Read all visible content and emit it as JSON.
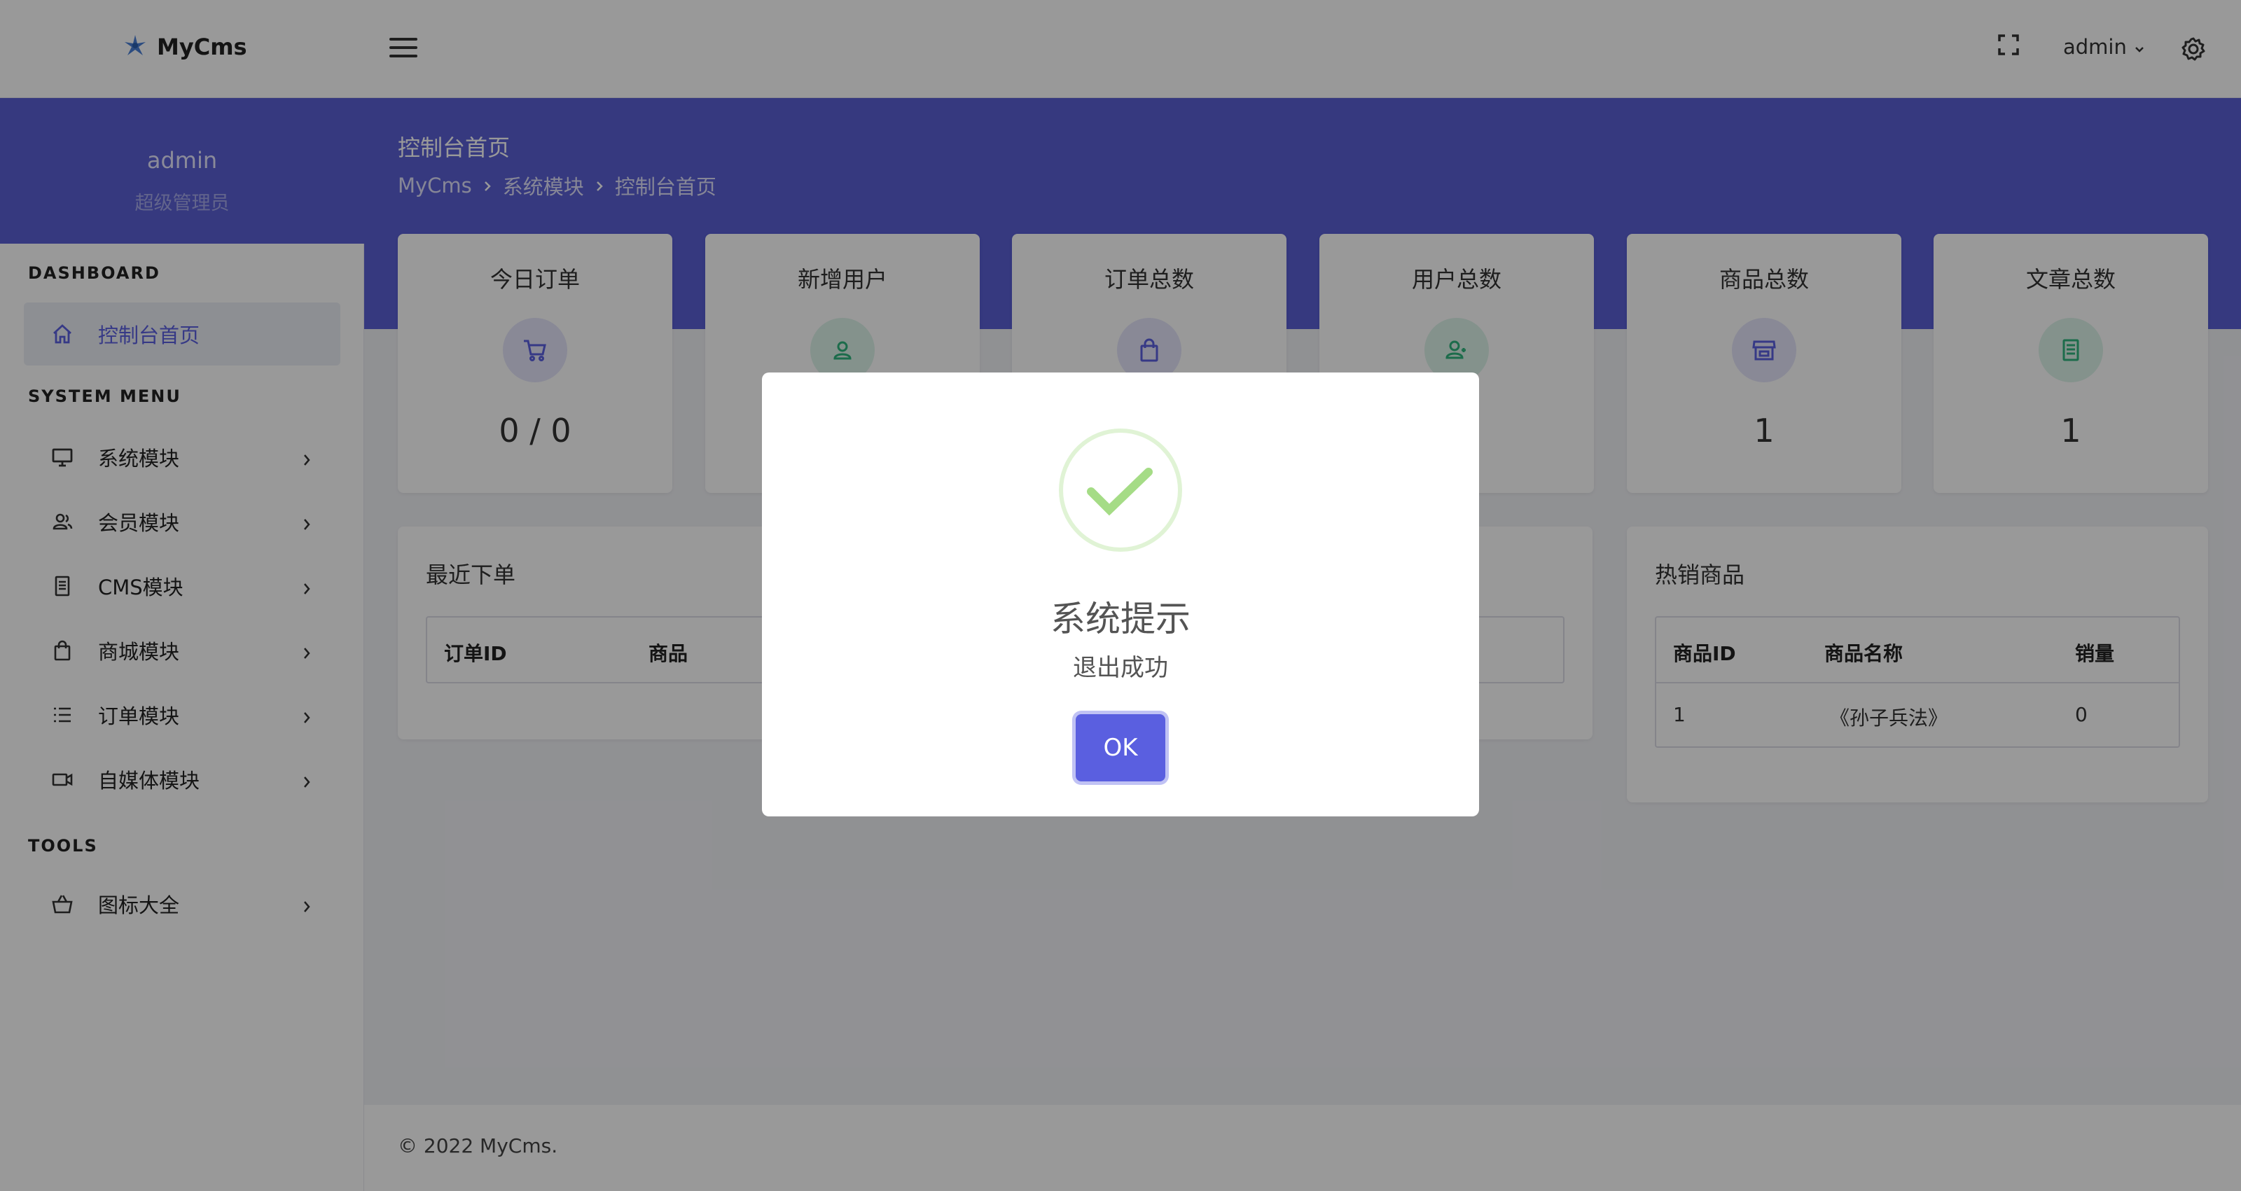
{
  "app": {
    "logo_text": "MyCms",
    "user_menu": "admin"
  },
  "sidebar": {
    "profile": {
      "name": "admin",
      "role": "超级管理员"
    },
    "sections": {
      "dashboard": "DASHBOARD",
      "system_menu": "SYSTEM MENU",
      "tools": "TOOLS"
    },
    "items": [
      {
        "label": "控制台首页",
        "icon": "home-icon",
        "active": true
      },
      {
        "label": "系统模块",
        "icon": "monitor-icon"
      },
      {
        "label": "会员模块",
        "icon": "users-icon"
      },
      {
        "label": "CMS模块",
        "icon": "document-icon"
      },
      {
        "label": "商城模块",
        "icon": "shopping-bag-icon"
      },
      {
        "label": "订单模块",
        "icon": "list-icon"
      },
      {
        "label": "自媒体模块",
        "icon": "video-icon"
      },
      {
        "label": "图标大全",
        "icon": "basket-icon"
      }
    ]
  },
  "page": {
    "title": "控制台首页",
    "breadcrumb": [
      "MyCms",
      "系统模块",
      "控制台首页"
    ]
  },
  "stats": [
    {
      "title": "今日订单",
      "value": "0 / 0",
      "icon": "cart-icon",
      "color": "#5a5fe0"
    },
    {
      "title": "新增用户",
      "value": "",
      "icon": "user-icon",
      "color": "#2fb57e"
    },
    {
      "title": "订单总数",
      "value": "",
      "icon": "bag-icon",
      "color": "#5a5fe0"
    },
    {
      "title": "用户总数",
      "value": "",
      "icon": "user-group-icon",
      "color": "#2fb57e"
    },
    {
      "title": "商品总数",
      "value": "1",
      "icon": "store-icon",
      "color": "#5a5fe0"
    },
    {
      "title": "文章总数",
      "value": "1",
      "icon": "article-icon",
      "color": "#2fb57e"
    }
  ],
  "recent_orders": {
    "title": "最近下单",
    "columns": [
      "订单ID",
      "商品"
    ]
  },
  "hot_products": {
    "title": "热销商品",
    "columns": [
      "商品ID",
      "商品名称",
      "销量"
    ],
    "rows": [
      [
        "1",
        "《孙子兵法》",
        "0"
      ]
    ]
  },
  "footer": {
    "text": "© 2022 MyCms."
  },
  "modal": {
    "title": "系统提示",
    "message": "退出成功",
    "ok_label": "OK",
    "success_color": "#a5dc86"
  }
}
